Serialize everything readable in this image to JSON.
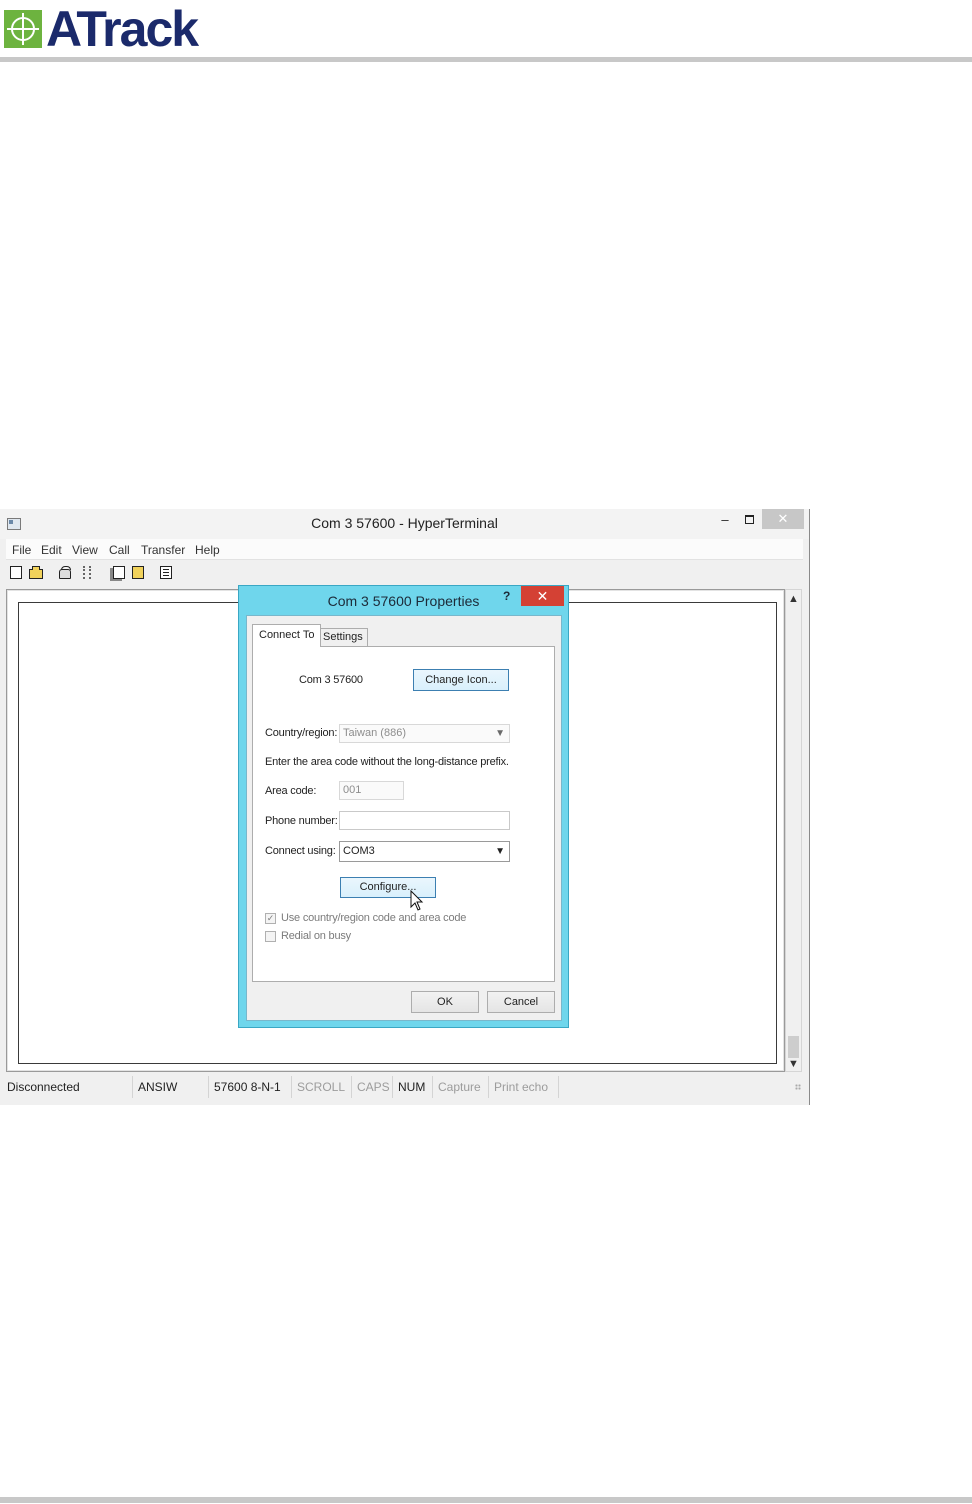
{
  "document": {
    "logo_text": "ATrack"
  },
  "window": {
    "title": "Com 3 57600 - HyperTerminal",
    "controls": {
      "minimize": "–",
      "close": "✕"
    },
    "menu": [
      "File",
      "Edit",
      "View",
      "Call",
      "Transfer",
      "Help"
    ],
    "toolbar_icons": [
      "new-file-icon",
      "open-folder-icon",
      "call-icon",
      "disconnect-icon",
      "send-file-icon",
      "receive-file-icon",
      "properties-icon"
    ],
    "scrollbar": {
      "up": "▲",
      "down": "▼"
    },
    "status": {
      "connection": "Disconnected",
      "emulation": "ANSIW",
      "port_settings": "57600 8-N-1",
      "scroll": "SCROLL",
      "caps": "CAPS",
      "num": "NUM",
      "capture": "Capture",
      "print_echo": "Print echo"
    }
  },
  "dialog": {
    "title": "Com 3 57600 Properties",
    "help": "?",
    "close": "✕",
    "tabs": [
      "Connect To",
      "Settings"
    ],
    "active_tab": "Connect To",
    "connection_name": "Com 3 57600",
    "change_icon_label": "Change Icon...",
    "country_label": "Country/region:",
    "country_value": "Taiwan (886)",
    "area_instruction": "Enter the area code without the long-distance prefix.",
    "area_code_label": "Area code:",
    "area_code_value": "001",
    "phone_label": "Phone number:",
    "phone_value": "",
    "connect_using_label": "Connect using:",
    "connect_using_value": "COM3",
    "configure_label": "Configure...",
    "use_country_label": "Use country/region code and area code",
    "use_country_checked": true,
    "redial_label": "Redial on busy",
    "redial_checked": false,
    "ok_label": "OK",
    "cancel_label": "Cancel"
  },
  "colors": {
    "dialog_frame": "#6fd6ec",
    "close_button": "#d44134",
    "logo_green": "#6db33f",
    "logo_navy": "#1b2a6b"
  }
}
